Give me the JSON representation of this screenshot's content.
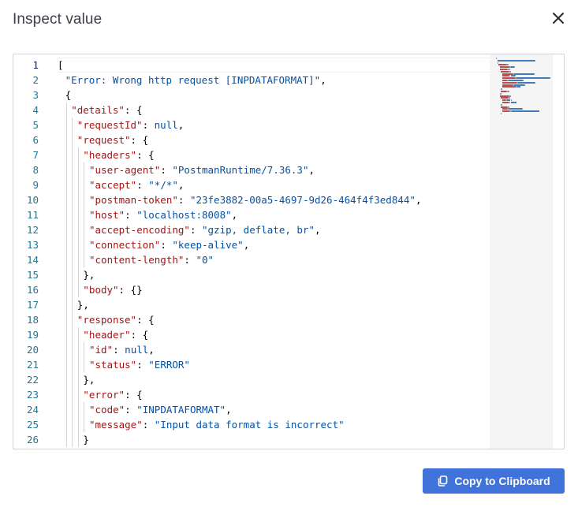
{
  "dialog": {
    "title": "Inspect value",
    "close_icon": "close-icon"
  },
  "editor": {
    "lines": [
      {
        "num": "1",
        "indent": 0,
        "tokens": [
          {
            "t": "p",
            "v": "["
          }
        ]
      },
      {
        "num": "2",
        "indent": 1,
        "tokens": [
          {
            "t": "s",
            "v": "\"Error: Wrong http request [INPDATAFORMAT]\""
          },
          {
            "t": "p",
            "v": ","
          }
        ]
      },
      {
        "num": "3",
        "indent": 1,
        "tokens": [
          {
            "t": "p",
            "v": "{"
          }
        ]
      },
      {
        "num": "4",
        "indent": 2,
        "tokens": [
          {
            "t": "k",
            "v": "\"details\""
          },
          {
            "t": "p",
            "v": ": {"
          }
        ]
      },
      {
        "num": "5",
        "indent": 3,
        "tokens": [
          {
            "t": "k",
            "v": "\"requestId\""
          },
          {
            "t": "p",
            "v": ": "
          },
          {
            "t": "n",
            "v": "null"
          },
          {
            "t": "p",
            "v": ","
          }
        ]
      },
      {
        "num": "6",
        "indent": 3,
        "tokens": [
          {
            "t": "k",
            "v": "\"request\""
          },
          {
            "t": "p",
            "v": ": {"
          }
        ]
      },
      {
        "num": "7",
        "indent": 4,
        "tokens": [
          {
            "t": "k",
            "v": "\"headers\""
          },
          {
            "t": "p",
            "v": ": {"
          }
        ]
      },
      {
        "num": "8",
        "indent": 5,
        "tokens": [
          {
            "t": "k",
            "v": "\"user-agent\""
          },
          {
            "t": "p",
            "v": ": "
          },
          {
            "t": "s",
            "v": "\"PostmanRuntime/7.36.3\""
          },
          {
            "t": "p",
            "v": ","
          }
        ]
      },
      {
        "num": "9",
        "indent": 5,
        "tokens": [
          {
            "t": "k",
            "v": "\"accept\""
          },
          {
            "t": "p",
            "v": ": "
          },
          {
            "t": "s",
            "v": "\"*/*\""
          },
          {
            "t": "p",
            "v": ","
          }
        ]
      },
      {
        "num": "10",
        "indent": 5,
        "tokens": [
          {
            "t": "k",
            "v": "\"postman-token\""
          },
          {
            "t": "p",
            "v": ": "
          },
          {
            "t": "s",
            "v": "\"23fe3882-00a5-4697-9d26-464f4f3ed844\""
          },
          {
            "t": "p",
            "v": ","
          }
        ]
      },
      {
        "num": "11",
        "indent": 5,
        "tokens": [
          {
            "t": "k",
            "v": "\"host\""
          },
          {
            "t": "p",
            "v": ": "
          },
          {
            "t": "s",
            "v": "\"localhost:8008\""
          },
          {
            "t": "p",
            "v": ","
          }
        ]
      },
      {
        "num": "12",
        "indent": 5,
        "tokens": [
          {
            "t": "k",
            "v": "\"accept-encoding\""
          },
          {
            "t": "p",
            "v": ": "
          },
          {
            "t": "s",
            "v": "\"gzip, deflate, br\""
          },
          {
            "t": "p",
            "v": ","
          }
        ]
      },
      {
        "num": "13",
        "indent": 5,
        "tokens": [
          {
            "t": "k",
            "v": "\"connection\""
          },
          {
            "t": "p",
            "v": ": "
          },
          {
            "t": "s",
            "v": "\"keep-alive\""
          },
          {
            "t": "p",
            "v": ","
          }
        ]
      },
      {
        "num": "14",
        "indent": 5,
        "tokens": [
          {
            "t": "k",
            "v": "\"content-length\""
          },
          {
            "t": "p",
            "v": ": "
          },
          {
            "t": "s",
            "v": "\"0\""
          }
        ]
      },
      {
        "num": "15",
        "indent": 4,
        "tokens": [
          {
            "t": "p",
            "v": "},"
          }
        ]
      },
      {
        "num": "16",
        "indent": 4,
        "tokens": [
          {
            "t": "k",
            "v": "\"body\""
          },
          {
            "t": "p",
            "v": ": {}"
          }
        ]
      },
      {
        "num": "17",
        "indent": 3,
        "tokens": [
          {
            "t": "p",
            "v": "},"
          }
        ]
      },
      {
        "num": "18",
        "indent": 3,
        "tokens": [
          {
            "t": "k",
            "v": "\"response\""
          },
          {
            "t": "p",
            "v": ": {"
          }
        ]
      },
      {
        "num": "19",
        "indent": 4,
        "tokens": [
          {
            "t": "k",
            "v": "\"header\""
          },
          {
            "t": "p",
            "v": ": {"
          }
        ]
      },
      {
        "num": "20",
        "indent": 5,
        "tokens": [
          {
            "t": "k",
            "v": "\"id\""
          },
          {
            "t": "p",
            "v": ": "
          },
          {
            "t": "n",
            "v": "null"
          },
          {
            "t": "p",
            "v": ","
          }
        ]
      },
      {
        "num": "21",
        "indent": 5,
        "tokens": [
          {
            "t": "k",
            "v": "\"status\""
          },
          {
            "t": "p",
            "v": ": "
          },
          {
            "t": "s",
            "v": "\"ERROR\""
          }
        ]
      },
      {
        "num": "22",
        "indent": 4,
        "tokens": [
          {
            "t": "p",
            "v": "},"
          }
        ]
      },
      {
        "num": "23",
        "indent": 4,
        "tokens": [
          {
            "t": "k",
            "v": "\"error\""
          },
          {
            "t": "p",
            "v": ": {"
          }
        ]
      },
      {
        "num": "24",
        "indent": 5,
        "tokens": [
          {
            "t": "k",
            "v": "\"code\""
          },
          {
            "t": "p",
            "v": ": "
          },
          {
            "t": "s",
            "v": "\"INPDATAFORMAT\""
          },
          {
            "t": "p",
            "v": ","
          }
        ]
      },
      {
        "num": "25",
        "indent": 5,
        "tokens": [
          {
            "t": "k",
            "v": "\"message\""
          },
          {
            "t": "p",
            "v": ": "
          },
          {
            "t": "s",
            "v": "\"Input data format is incorrect\""
          }
        ]
      },
      {
        "num": "26",
        "indent": 4,
        "tokens": [
          {
            "t": "p",
            "v": "}"
          }
        ]
      }
    ],
    "active_line": "1",
    "colors": {
      "key": "#a31515",
      "string": "#0451a5",
      "line_number": "#237893",
      "minimap_bg": "#f5f5f5"
    }
  },
  "footer": {
    "copy_label": "Copy to Clipboard",
    "copy_icon": "copy-icon",
    "button_color": "#3f73d9"
  }
}
